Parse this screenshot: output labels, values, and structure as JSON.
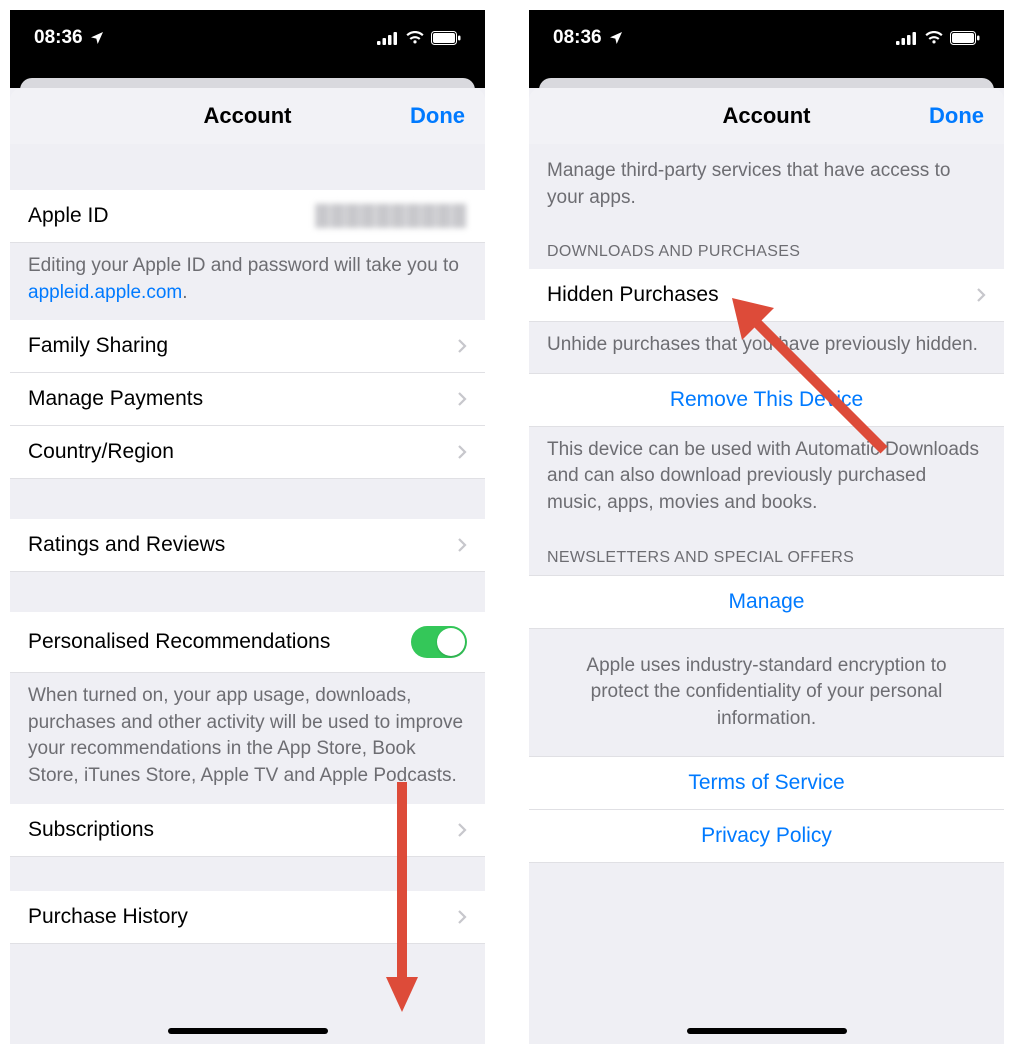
{
  "status": {
    "time": "08:36",
    "location_icon": "location-icon"
  },
  "nav": {
    "title": "Account",
    "done": "Done"
  },
  "left": {
    "apple_id_label": "Apple ID",
    "apple_id_value": "██████████",
    "apple_id_footer_pre": "Editing your Apple ID and password will take you to ",
    "apple_id_footer_link": "appleid.apple.com",
    "apple_id_footer_post": ".",
    "family_sharing": "Family Sharing",
    "manage_payments": "Manage Payments",
    "country_region": "Country/Region",
    "ratings_reviews": "Ratings and Reviews",
    "personalised_recs": "Personalised Recommendations",
    "personalised_footer": "When turned on, your app usage, downloads, purchases and other activity will be used to improve your recommendations in the App Store, Book Store, iTunes Store, Apple TV and Apple Podcasts.",
    "subscriptions": "Subscriptions",
    "purchase_history": "Purchase History"
  },
  "right": {
    "third_party_footer": "Manage third-party services that have access to your apps.",
    "downloads_header": "DOWNLOADS AND PURCHASES",
    "hidden_purchases": "Hidden Purchases",
    "hidden_footer": "Unhide purchases that you have previously hidden.",
    "remove_device": "Remove This Device",
    "remove_footer": "This device can be used with Automatic Downloads and can also download previously purchased music, apps, movies and books.",
    "newsletters_header": "NEWSLETTERS AND SPECIAL OFFERS",
    "manage": "Manage",
    "encryption_footer": "Apple uses industry-standard encryption to protect the confidentiality of your personal information.",
    "terms": "Terms of Service",
    "privacy": "Privacy Policy"
  }
}
